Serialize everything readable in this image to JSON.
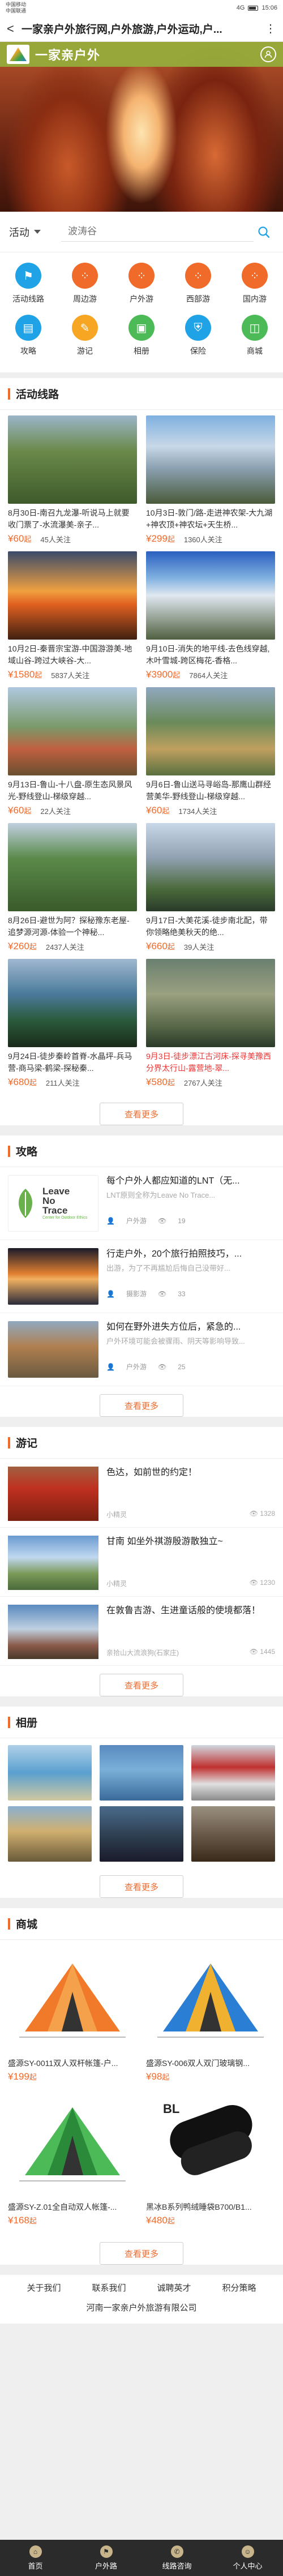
{
  "statusbar": {
    "carrier1": "中国移动",
    "carrier2": "中国联通",
    "signal": "4G",
    "time": "15:06"
  },
  "titlebar": {
    "back": "<",
    "title": "一家亲户外旅行网,户外旅游,户外运动,户...",
    "more": "⋮"
  },
  "hero": {
    "brand": "一家亲户外",
    "user_icon": "user-icon"
  },
  "search": {
    "select_label": "活动",
    "placeholder": "波涛谷"
  },
  "categories": [
    {
      "label": "活动线路",
      "color": "#1fa3e6",
      "icon": "flag-icon",
      "glyph": "⚑"
    },
    {
      "label": "周边游",
      "color": "#f06a2a",
      "icon": "grid-icon",
      "glyph": "⁘"
    },
    {
      "label": "户外游",
      "color": "#f06a2a",
      "icon": "grid-icon",
      "glyph": "⁘"
    },
    {
      "label": "西部游",
      "color": "#f06a2a",
      "icon": "grid-icon",
      "glyph": "⁘"
    },
    {
      "label": "国内游",
      "color": "#f06a2a",
      "icon": "grid-icon",
      "glyph": "⁘"
    },
    {
      "label": "攻略",
      "color": "#1fa3e6",
      "icon": "book-icon",
      "glyph": "▤"
    },
    {
      "label": "游记",
      "color": "#f6a623",
      "icon": "note-icon",
      "glyph": "✎"
    },
    {
      "label": "相册",
      "color": "#4cba57",
      "icon": "image-icon",
      "glyph": "▣"
    },
    {
      "label": "保险",
      "color": "#1fa3e6",
      "icon": "shield-icon",
      "glyph": "⛨"
    },
    {
      "label": "商城",
      "color": "#4cba57",
      "icon": "shop-icon",
      "glyph": "◫"
    }
  ],
  "routes": {
    "title": "活动线路",
    "more": "查看更多",
    "items": [
      {
        "title": "8月30日-南召九龙瀑-听说马上就要收门票了-水流瀑美-亲子...",
        "price": "¥60",
        "unit": "起",
        "attention": "45人关注",
        "red": false
      },
      {
        "title": "10月3日-敦门/路-走进神农架-大九湖+神农顶+神农坛+天生桥...",
        "price": "¥299",
        "unit": "起",
        "attention": "1360人关注",
        "red": false
      },
      {
        "title": "10月2日-秦晋宗宝游-中国游游美-地域山谷-跨过大峡谷-大...",
        "price": "¥1580",
        "unit": "起",
        "attention": "5837人关注",
        "red": false
      },
      {
        "title": "9月10日-消失的地平线-去色线穿越,木叶雪城-跨区梅花-香格...",
        "price": "¥3900",
        "unit": "起",
        "attention": "7864人关注",
        "red": false
      },
      {
        "title": "9月13日-鲁山-十八盘-原生态风景风光-野线登山-梯级穿越...",
        "price": "¥60",
        "unit": "起",
        "attention": "22人关注",
        "red": false
      },
      {
        "title": "9月6日-鲁山送马寻峪岛-那鹰山群经营美华-野线登山-梯级穿越...",
        "price": "¥60",
        "unit": "起",
        "attention": "1734人关注",
        "red": false
      },
      {
        "title": "8月26日-避世为阿？探秘豫东老屋-追梦源河源-体验一个神秘...",
        "price": "¥260",
        "unit": "起",
        "attention": "2437人关注",
        "red": false
      },
      {
        "title": "9月17日-大美花溪-徒步南北配，带你领略绝美秋天的绝...",
        "price": "¥660",
        "unit": "起",
        "attention": "39人关注",
        "red": false
      },
      {
        "title": "9月24日-徒步秦岭首脊-水晶坪-兵马营-商马梁-鹤梁-探秘秦...",
        "price": "¥680",
        "unit": "起",
        "attention": "211人关注",
        "red": false
      },
      {
        "title": "9月3日-徒步漂江古河床-探寻美豫西分界太行山-露营地-翠...",
        "price": "¥580",
        "unit": "起",
        "attention": "2767人关注",
        "red": true
      }
    ]
  },
  "guides": {
    "title": "攻略",
    "more": "查看更多",
    "items": [
      {
        "title": "每个户外人都应知道的LNT（无...",
        "desc": "LNT原则全称为Leave No Trace...",
        "author": "户外游",
        "views": "19",
        "logo_line1": "Leave",
        "logo_line2": "No",
        "logo_line3": "Trace",
        "logo_sub": "Center for Outdoor Ethics"
      },
      {
        "title": "行走户外，20个旅行拍照技巧，...",
        "desc": "出游，为了不再尴尬后悔自己没带好...",
        "author": "摄影游",
        "views": "33"
      },
      {
        "title": "如何在野外进失方位后，紧急的...",
        "desc": "户外环境可能会被骤雨、阴天等影响导致...",
        "author": "户外游",
        "views": "25"
      }
    ]
  },
  "journals": {
    "title": "游记",
    "more": "查看更多",
    "items": [
      {
        "title": "色达，如前世的约定！",
        "author": "小精灵",
        "views": "1328"
      },
      {
        "title": "甘南 如坐外祺游殷游散独立~",
        "author": "小精灵",
        "views": "1230"
      },
      {
        "title": "在敦鲁吉游、生进童话般的使境都落！",
        "author": "亲拾山大流浪狗(石家庄)",
        "views": "1445"
      }
    ]
  },
  "albums": {
    "title": "相册",
    "more": "查看更多"
  },
  "shop": {
    "title": "商城",
    "more": "查看更多",
    "items": [
      {
        "title": "盛源SY-0011双人双杆帐篷-户...",
        "price": "¥199",
        "unit": "起"
      },
      {
        "title": "盛源SY-006双人双门玻璃钢...",
        "price": "¥98",
        "unit": "起"
      },
      {
        "title": "盛源SY-Z.01全自动双人帐篷-...",
        "price": "¥168",
        "unit": "起"
      },
      {
        "title": "黑冰B系列鸭绒睡袋B700/B1...",
        "price": "¥480",
        "unit": "起"
      }
    ]
  },
  "footer": {
    "links": [
      "关于我们",
      "联系我们",
      "诚聘英才",
      "积分策略"
    ],
    "copyright": "河南一家亲户外旅游有限公司"
  },
  "tabbar": [
    {
      "label": "首页",
      "icon": "home-icon"
    },
    {
      "label": "户外路",
      "icon": "route-icon"
    },
    {
      "label": "线路咨询",
      "icon": "phone-icon"
    },
    {
      "label": "个人中心",
      "icon": "person-icon"
    }
  ]
}
